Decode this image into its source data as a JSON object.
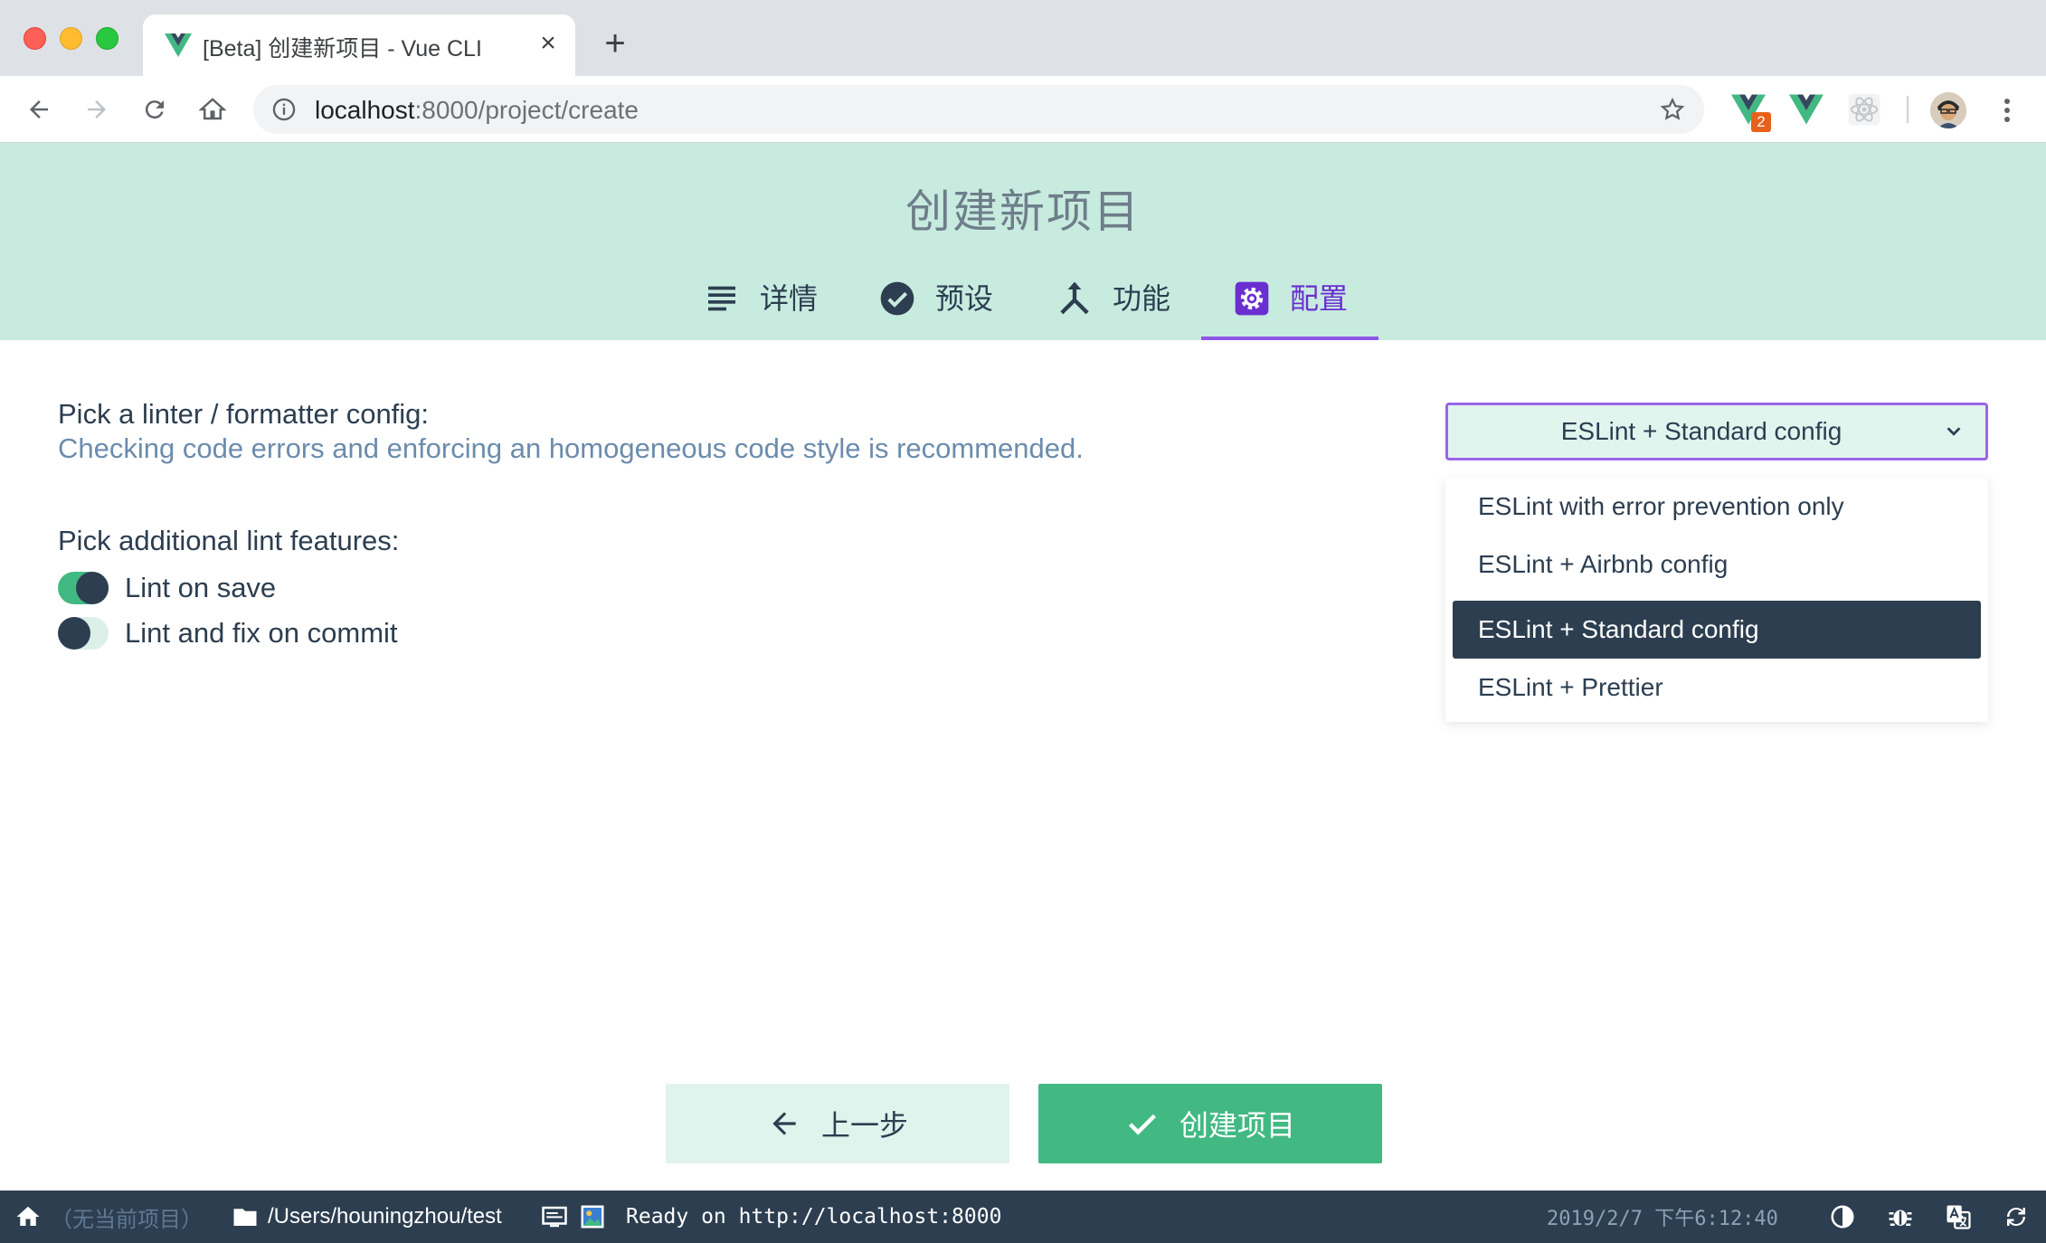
{
  "browser": {
    "tab_title": "[Beta] 创建新项目 - Vue CLI",
    "tab_close": "×",
    "new_tab": "+",
    "url_host": "localhost",
    "url_rest": ":8000/project/create",
    "extension_badge": "2"
  },
  "header": {
    "title": "创建新项目",
    "tabs": [
      {
        "label": "详情",
        "icon": "subject-icon"
      },
      {
        "label": "预设",
        "icon": "check-circle-icon"
      },
      {
        "label": "功能",
        "icon": "call-split-icon"
      },
      {
        "label": "配置",
        "icon": "settings-icon",
        "active": true
      }
    ]
  },
  "config": {
    "linter_label": "Pick a linter / formatter config:",
    "linter_desc": "Checking code errors and enforcing an homogeneous code style is recommended.",
    "select_value": "ESLint + Standard config",
    "options": [
      "ESLint with error prevention only",
      "ESLint + Airbnb config",
      "ESLint + Standard config",
      "ESLint + Prettier"
    ],
    "lint_features_label": "Pick additional lint features:",
    "toggles": [
      {
        "label": "Lint on save",
        "on": true
      },
      {
        "label": "Lint and fix on commit",
        "on": false
      }
    ]
  },
  "actions": {
    "prev_label": "上一步",
    "create_label": "创建项目"
  },
  "statusbar": {
    "project": "（无当前项目）",
    "cwd": "/Users/houningzhou/test",
    "log": "Ready on http://localhost:8000",
    "time": "2019/2/7 下午6:12:40"
  },
  "colors": {
    "vue_green": "#42b983",
    "dark": "#2c3e50",
    "accent_purple": "#8e56e6",
    "header_bg": "#c8ebdf"
  }
}
